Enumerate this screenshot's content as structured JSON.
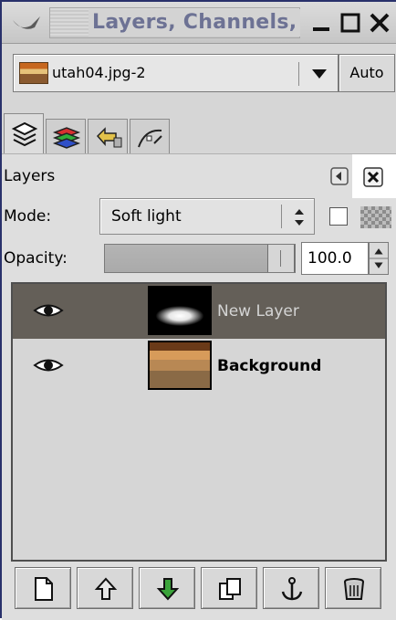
{
  "window": {
    "title": "Layers, Channels,"
  },
  "image_selector": {
    "value": "utah04.jpg-2",
    "auto_label": "Auto"
  },
  "tabs": [
    {
      "name": "layers-tab",
      "active": true
    },
    {
      "name": "channels-tab",
      "active": false
    },
    {
      "name": "undo-history-tab",
      "active": false
    },
    {
      "name": "paths-tab",
      "active": false
    }
  ],
  "panel": {
    "label": "Layers",
    "mode_label": "Mode:",
    "mode_value": "Soft light",
    "opacity_label": "Opacity:",
    "opacity_value": "100.0",
    "opacity_fraction": 1.0
  },
  "layers": [
    {
      "name": "New Layer",
      "visible": true,
      "selected": true
    },
    {
      "name": "Background",
      "visible": true,
      "selected": false
    }
  ],
  "bottom_buttons": [
    "new-layer-icon",
    "raise-layer-icon",
    "lower-layer-icon",
    "duplicate-layer-icon",
    "anchor-layer-icon",
    "delete-layer-icon"
  ],
  "colors": {
    "selected_row": "#645f58",
    "title_text": "#6d7294",
    "window_border": "#29316b"
  }
}
